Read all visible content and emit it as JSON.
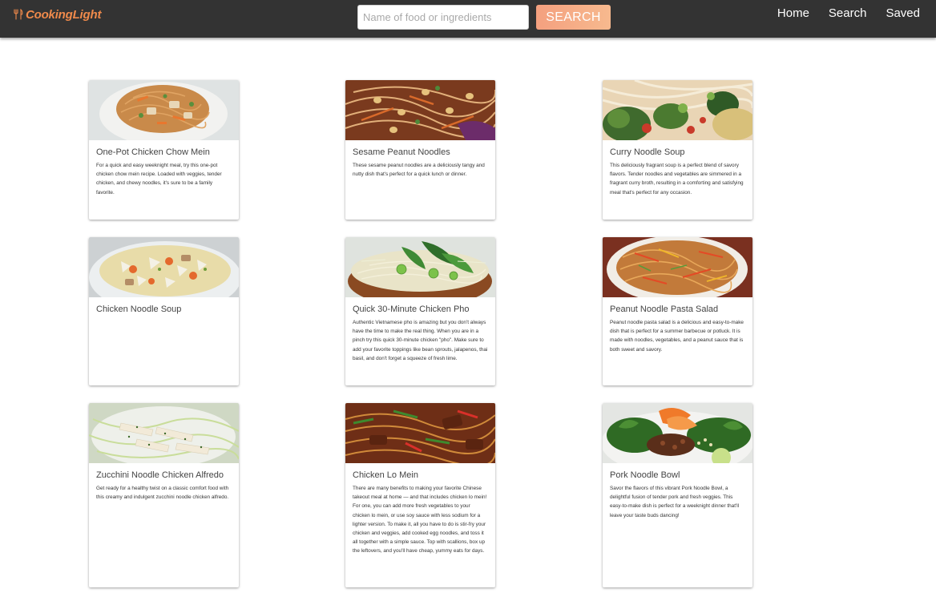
{
  "header": {
    "brand": "CookingLight",
    "brand_color": "#f08a4b",
    "search": {
      "placeholder": "Name of food or ingredients",
      "value": "",
      "button_label": "SEARCH"
    },
    "nav": [
      {
        "label": "Home"
      },
      {
        "label": "Search"
      },
      {
        "label": "Saved"
      }
    ]
  },
  "recipes": [
    {
      "title": "One-Pot Chicken Chow Mein",
      "description": "For a quick and easy weeknight meal, try this one-pot chicken chow mein recipe. Loaded with veggies, tender chicken, and chewy noodles, it's sure to be a family favorite."
    },
    {
      "title": "Sesame Peanut Noodles",
      "description": "These sesame peanut noodles are a deliciously tangy and nutty dish that's perfect for a quick lunch or dinner."
    },
    {
      "title": "Curry Noodle Soup",
      "description": "This deliciously fragrant soup is a perfect blend of savory flavors. Tender noodles and vegetables are simmered in a fragrant curry broth, resulting in a comforting and satisfying meal that's perfect for any occasion."
    },
    {
      "title": "Chicken Noodle Soup",
      "description": ""
    },
    {
      "title": "Quick 30-Minute Chicken Pho",
      "description": "Authentic Vietnamese pho is amazing but you don't always have the time to make the real thing. When you are in a pinch try this quick 30-minute chicken \"pho\". Make sure to add your favorite toppings like bean sprouts, jalapenos, thai basil, and don't forget a squeeze of fresh lime."
    },
    {
      "title": "Peanut Noodle Pasta Salad",
      "description": "Peanut noodle pasta salad is a delicious and easy-to-make dish that is perfect for a summer barbecue or potluck. It is made with noodles, vegetables, and a peanut sauce that is both sweet and savory."
    },
    {
      "title": "Zucchini Noodle Chicken Alfredo",
      "description": "Get ready for a healthy twist on a classic comfort food with this creamy and indulgent zucchini noodle chicken alfredo."
    },
    {
      "title": "Chicken Lo Mein",
      "description": "There are many benefits to making your favorite Chinese takeout meal at home — and that includes chicken lo mein! For one, you can add more fresh vegetables to your chicken lo mein, or use soy sauce with less sodium for a lighter version. To make it, all you have to do is stir-fry your chicken and veggies, add cooked egg noodles, and toss it all together with a simple sauce. Top with scallions, box up the leftovers, and you'll have cheap, yummy eats for days."
    },
    {
      "title": "Pork Noodle Bowl",
      "description": "Savor the flavors of this vibrant Pork Noodle Bowl, a delightful fusion of tender pork and fresh veggies. This easy-to-make dish is perfect for a weeknight dinner that'll leave your taste buds dancing!"
    }
  ]
}
